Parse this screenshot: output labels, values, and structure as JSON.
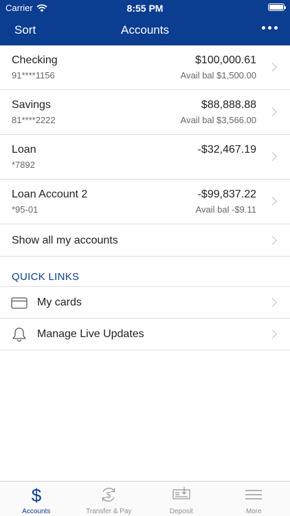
{
  "status_bar": {
    "carrier": "Carrier",
    "time": "8:55 PM"
  },
  "nav": {
    "sort_label": "Sort",
    "title": "Accounts",
    "more_icon": "more-horizontal-icon"
  },
  "accounts": [
    {
      "name": "Checking",
      "number": "91****1156",
      "balance": "$100,000.61",
      "available": "Avail bal $1,500.00"
    },
    {
      "name": "Savings",
      "number": "81****2222",
      "balance": "$88,888.88",
      "available": "Avail bal $3,566.00"
    },
    {
      "name": "Loan",
      "number": "*7892",
      "balance": "-$32,467.19",
      "available": ""
    },
    {
      "name": "Loan Account 2",
      "number": "*95-01",
      "balance": "-$99,837.22",
      "available": "Avail bal -$9.11"
    }
  ],
  "show_all_label": "Show all my accounts",
  "quick_links": {
    "header": "QUICK LINKS",
    "items": [
      {
        "label": "My cards",
        "icon": "credit-card-icon"
      },
      {
        "label": "Manage Live Updates",
        "icon": "bell-icon"
      }
    ]
  },
  "tabs": [
    {
      "label": "Accounts",
      "icon": "dollar-icon",
      "active": true
    },
    {
      "label": "Transfer & Pay",
      "icon": "transfer-icon",
      "active": false
    },
    {
      "label": "Deposit",
      "icon": "check-deposit-icon",
      "active": false
    },
    {
      "label": "More",
      "icon": "menu-icon",
      "active": false
    }
  ],
  "colors": {
    "brand_blue": "#0b3d91",
    "divider": "#dedede",
    "inactive_tab": "#8e8e93"
  }
}
